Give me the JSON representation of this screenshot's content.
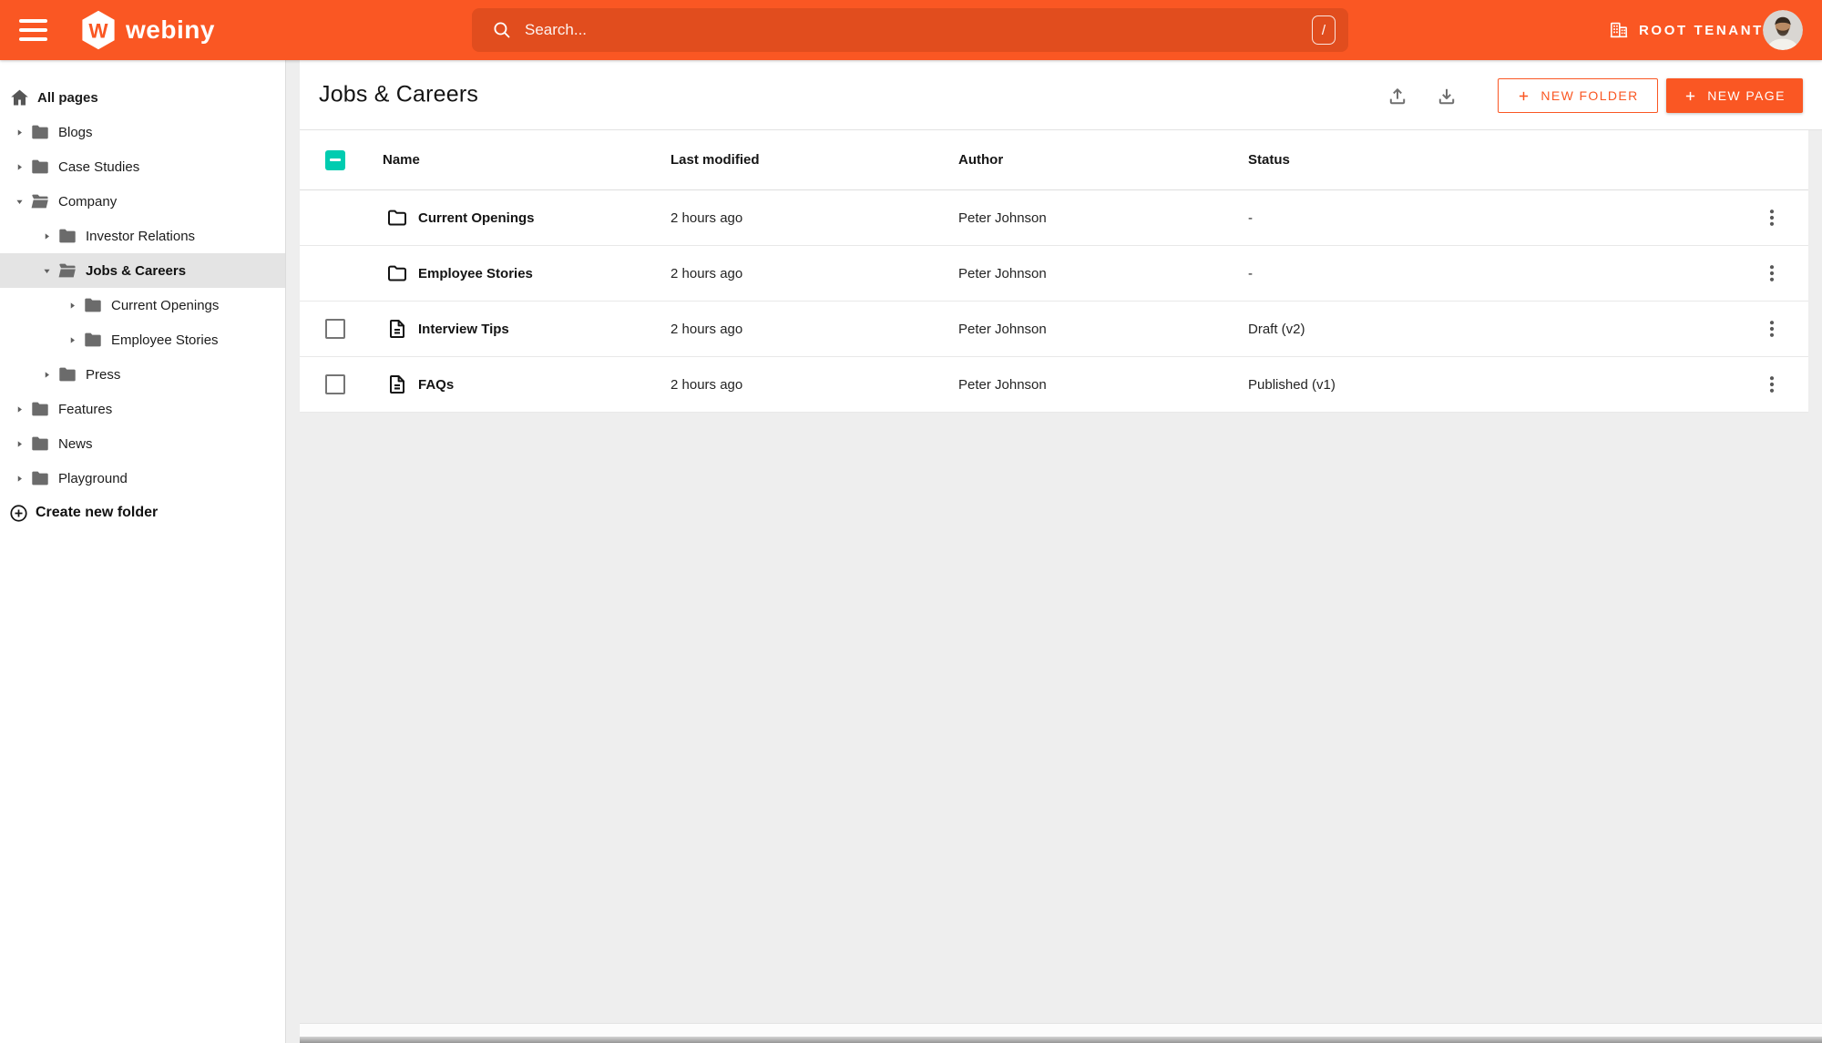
{
  "topbar": {
    "logo_letter": "W",
    "logo_text": "webiny",
    "search_placeholder": "Search...",
    "search_shortcut": "/",
    "tenant_label": "ROOT TENANT"
  },
  "sidebar": {
    "items": [
      {
        "label": "All pages",
        "type": "home",
        "selected": false
      },
      {
        "label": "Blogs",
        "type": "folder",
        "level": 0,
        "expanded": false
      },
      {
        "label": "Case Studies",
        "type": "folder",
        "level": 0,
        "expanded": false
      },
      {
        "label": "Company",
        "type": "folder",
        "level": 0,
        "expanded": true
      },
      {
        "label": "Investor Relations",
        "type": "folder",
        "level": 1,
        "expanded": false
      },
      {
        "label": "Jobs & Careers",
        "type": "folder",
        "level": 1,
        "expanded": true,
        "selected": true
      },
      {
        "label": "Current Openings",
        "type": "folder",
        "level": 2,
        "expanded": false
      },
      {
        "label": "Employee Stories",
        "type": "folder",
        "level": 2,
        "expanded": false
      },
      {
        "label": "Press",
        "type": "folder",
        "level": 1,
        "expanded": false
      },
      {
        "label": "Features",
        "type": "folder",
        "level": 0,
        "expanded": false
      },
      {
        "label": "News",
        "type": "folder",
        "level": 0,
        "expanded": false
      },
      {
        "label": "Playground",
        "type": "folder",
        "level": 0,
        "expanded": false
      }
    ],
    "create_folder_label": "Create new folder"
  },
  "main": {
    "title": "Jobs & Careers",
    "new_folder_label": "NEW FOLDER",
    "new_page_label": "NEW PAGE",
    "table": {
      "columns": {
        "name": "Name",
        "modified": "Last modified",
        "author": "Author",
        "status": "Status"
      },
      "select_all_state": "indeterminate",
      "rows": [
        {
          "type": "folder",
          "name": "Current Openings",
          "modified": "2 hours ago",
          "author": "Peter Johnson",
          "status": "-",
          "has_checkbox": false
        },
        {
          "type": "folder",
          "name": "Employee Stories",
          "modified": "2 hours ago",
          "author": "Peter Johnson",
          "status": "-",
          "has_checkbox": false
        },
        {
          "type": "page",
          "name": "Interview Tips",
          "modified": "2 hours ago",
          "author": "Peter Johnson",
          "status": "Draft (v2)",
          "has_checkbox": true
        },
        {
          "type": "page",
          "name": "FAQs",
          "modified": "2 hours ago",
          "author": "Peter Johnson",
          "status": "Published (v1)",
          "has_checkbox": true
        }
      ]
    }
  },
  "colors": {
    "primary": "#fa5723",
    "secondary": "#00ccb0",
    "main_background": "#eeeeee"
  }
}
